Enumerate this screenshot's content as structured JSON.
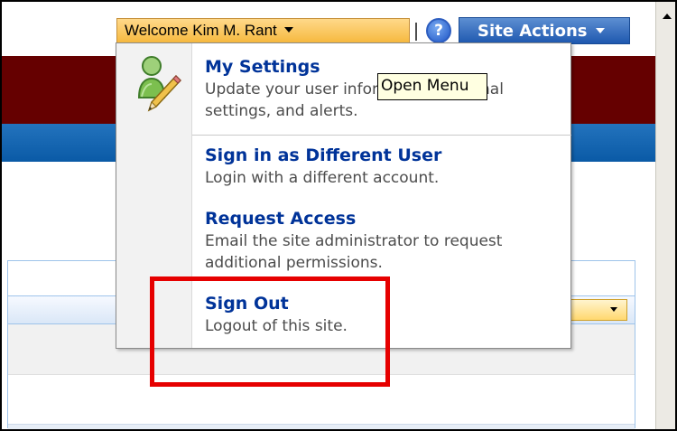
{
  "topbar": {
    "welcome_label": "Welcome Kim M. Rant",
    "help_icon": "?",
    "site_actions_label": "Site Actions"
  },
  "menu": {
    "items": [
      {
        "title": "My Settings",
        "description": "Update your user information, regional settings, and alerts."
      },
      {
        "title": "Sign in as Different User",
        "description": "Login with a different account."
      },
      {
        "title": "Request Access",
        "description": "Email the site administrator to request additional permissions."
      },
      {
        "title": "Sign Out",
        "description": "Logout of this site."
      }
    ]
  },
  "tooltip": {
    "text": "Open Menu"
  },
  "icons": {
    "user_settings": "user-pencil-icon",
    "help": "help-icon",
    "dropdown": "chevron-down-icon"
  },
  "colors": {
    "maroon_band": "#650000",
    "blue_band": "#1565b0",
    "menu_link": "#003399",
    "highlight": "#e60000",
    "welcome_bg": "#f6b93f",
    "site_actions_bg": "#1e58af"
  }
}
